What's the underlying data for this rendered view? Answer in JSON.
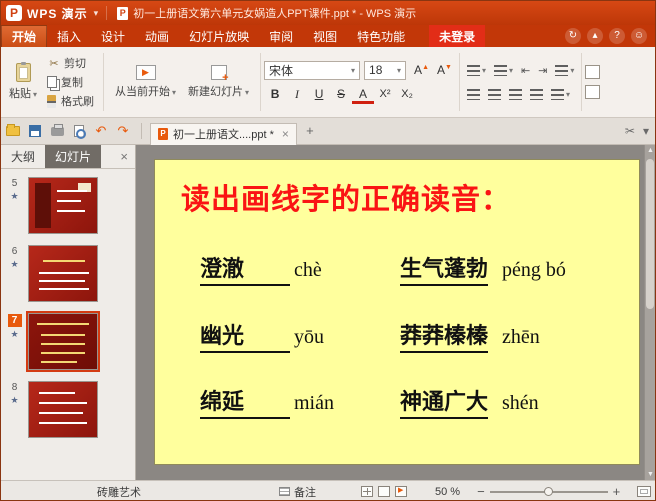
{
  "titlebar": {
    "logo": "P",
    "app_name": "WPS 演示",
    "doc_title": "初一上册语文第六单元女娲造人PPT课件.ppt * - WPS 演示"
  },
  "ribbon_tabs": {
    "items": [
      {
        "label": "开始"
      },
      {
        "label": "插入"
      },
      {
        "label": "设计"
      },
      {
        "label": "动画"
      },
      {
        "label": "幻灯片放映"
      },
      {
        "label": "审阅"
      },
      {
        "label": "视图"
      },
      {
        "label": "特色功能"
      }
    ],
    "login_label": "未登录"
  },
  "ribbon": {
    "paste_label": "粘贴",
    "cut_label": "剪切",
    "copy_label": "复制",
    "format_painter_label": "格式刷",
    "from_current_label": "从当前开始",
    "new_slide_label": "新建幻灯片",
    "font_name": "宋体",
    "font_size": "18",
    "bold": "B",
    "italic": "I",
    "underline": "U",
    "strikethrough": "S",
    "font_color": "A",
    "superscript": "X²",
    "subscript": "X₂"
  },
  "doc_tabs": {
    "active_tab": "初一上册语文....ppt *"
  },
  "sidebar": {
    "outline_tab": "大纲",
    "slides_tab": "幻灯片",
    "slides": [
      {
        "number": "5"
      },
      {
        "number": "6"
      },
      {
        "number": "7"
      },
      {
        "number": "8"
      }
    ]
  },
  "slide": {
    "title": "读出画线字的正确读音：",
    "rows": [
      {
        "left_word": "澄澈",
        "left_pinyin": "chè",
        "right_word": "生气蓬勃",
        "right_pinyin": "péng bó"
      },
      {
        "left_word": "幽光",
        "left_pinyin": "yōu",
        "right_word": "莽莽榛榛",
        "right_pinyin": "zhēn"
      },
      {
        "left_word": "绵延",
        "left_pinyin": "mián",
        "right_word": "神通广大",
        "right_pinyin": "shén"
      }
    ]
  },
  "statusbar": {
    "theme_name": "砖雕艺术",
    "notes_label": "备注",
    "zoom_value": "50 %"
  },
  "icons": {
    "caret_down": "▾",
    "close": "×",
    "new_tab": "+",
    "scissors": "✂",
    "undo": "↶",
    "redo": "↷",
    "star": "★",
    "play": "▶",
    "help": "?",
    "smiley": "☺",
    "skin": "↻",
    "collapse": "▴",
    "zoom_out": "−",
    "zoom_in": "+",
    "indent_left": "⇤",
    "indent_right": "⇥",
    "scroll_up": "▲",
    "scroll_down": "▼"
  }
}
